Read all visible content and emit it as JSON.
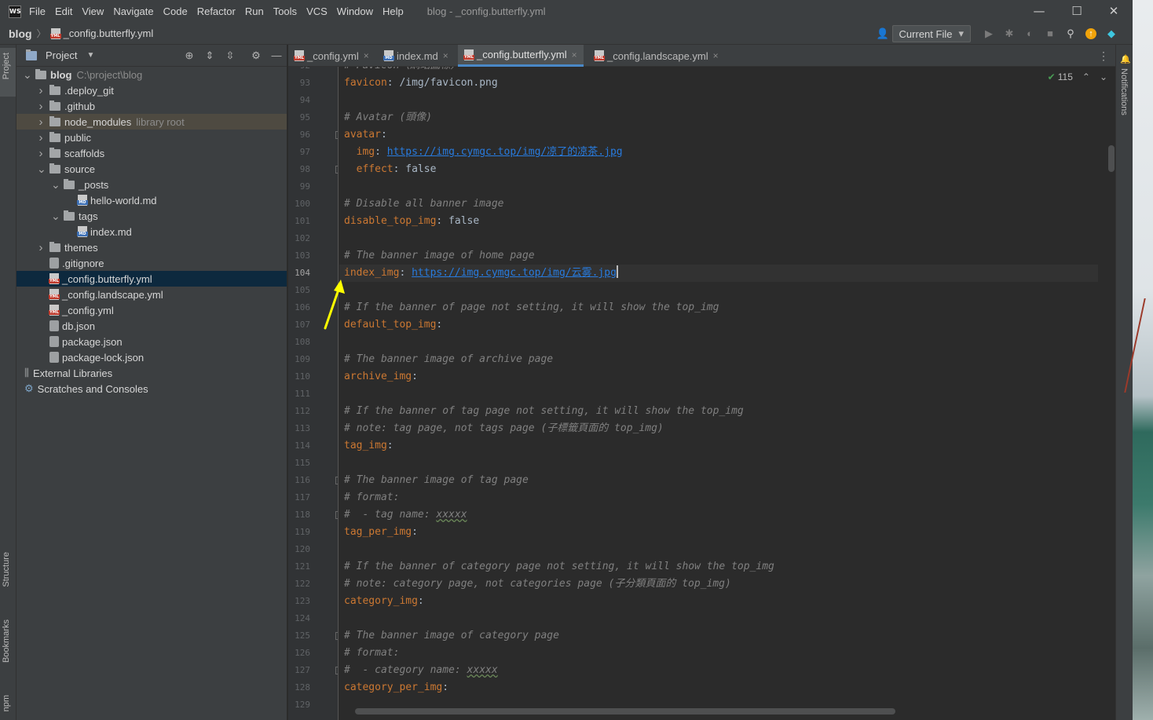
{
  "titlebar": {
    "app_logo": "WS",
    "menu": [
      "File",
      "Edit",
      "View",
      "Navigate",
      "Code",
      "Refactor",
      "Run",
      "Tools",
      "VCS",
      "Window",
      "Help"
    ],
    "window_title": "blog - _config.butterfly.yml",
    "controls": {
      "minimize": "—",
      "maximize": "☐",
      "close": "✕"
    }
  },
  "navbar": {
    "root": "blog",
    "separator": "〉",
    "file": "_config.butterfly.yml",
    "run_config": "Current File",
    "dropdown": "▾"
  },
  "left_strip": {
    "project": "Project",
    "structure": "Structure",
    "bookmarks": "Bookmarks",
    "npm": "npm"
  },
  "project_panel": {
    "title": "Project",
    "tree": [
      {
        "label": "blog",
        "hint": "C:\\project\\blog",
        "type": "folder",
        "level": 0,
        "expanded": true
      },
      {
        "label": ".deploy_git",
        "type": "folder",
        "level": 1,
        "expanded": false
      },
      {
        "label": ".github",
        "type": "folder",
        "level": 1,
        "expanded": false
      },
      {
        "label": "node_modules",
        "hint": "library root",
        "type": "folder",
        "level": 1,
        "expanded": false,
        "state": "excluded"
      },
      {
        "label": "public",
        "type": "folder",
        "level": 1,
        "expanded": false
      },
      {
        "label": "scaffolds",
        "type": "folder",
        "level": 1,
        "expanded": false
      },
      {
        "label": "source",
        "type": "folder",
        "level": 1,
        "expanded": true
      },
      {
        "label": "_posts",
        "type": "folder",
        "level": 2,
        "expanded": true
      },
      {
        "label": "hello-world.md",
        "type": "md",
        "level": 3
      },
      {
        "label": "tags",
        "type": "folder",
        "level": 2,
        "expanded": true
      },
      {
        "label": "index.md",
        "type": "md",
        "level": 3
      },
      {
        "label": "themes",
        "type": "folder",
        "level": 1,
        "expanded": false
      },
      {
        "label": ".gitignore",
        "type": "cfg",
        "level": 1
      },
      {
        "label": "_config.butterfly.yml",
        "type": "yml",
        "level": 1,
        "state": "selected"
      },
      {
        "label": "_config.landscape.yml",
        "type": "yml",
        "level": 1
      },
      {
        "label": "_config.yml",
        "type": "yml",
        "level": 1
      },
      {
        "label": "db.json",
        "type": "cfg",
        "level": 1
      },
      {
        "label": "package.json",
        "type": "cfg",
        "level": 1
      },
      {
        "label": "package-lock.json",
        "type": "cfg",
        "level": 1
      },
      {
        "label": "External Libraries",
        "type": "lib",
        "level": 0
      },
      {
        "label": "Scratches and Consoles",
        "type": "scratch",
        "level": 0
      }
    ]
  },
  "tabs": [
    {
      "label": "_config.yml",
      "type": "yml",
      "active": false
    },
    {
      "label": "index.md",
      "type": "md",
      "active": false
    },
    {
      "label": "_config.butterfly.yml",
      "type": "yml",
      "active": true
    },
    {
      "label": "_config.landscape.yml",
      "type": "yml",
      "active": false
    }
  ],
  "inspections": {
    "count": "115"
  },
  "editor": {
    "current_line": "104",
    "lines": [
      {
        "n": "92",
        "parts": [
          [
            "c",
            "# Favicon（網站圖標）"
          ]
        ]
      },
      {
        "n": "93",
        "parts": [
          [
            "k",
            "favicon"
          ],
          [
            "p",
            ": /img/favicon.png"
          ]
        ]
      },
      {
        "n": "94",
        "parts": []
      },
      {
        "n": "95",
        "parts": [
          [
            "c",
            "# Avatar (頭像)"
          ]
        ]
      },
      {
        "n": "96",
        "parts": [
          [
            "k",
            "avatar"
          ],
          [
            "p",
            ":"
          ]
        ],
        "fold": true
      },
      {
        "n": "97",
        "parts": [
          [
            "p",
            "  "
          ],
          [
            "k",
            "img"
          ],
          [
            "p",
            ": "
          ],
          [
            "u",
            "https://img.cymgc.top/img/凉了的凉茶.jpg"
          ]
        ]
      },
      {
        "n": "98",
        "parts": [
          [
            "p",
            "  "
          ],
          [
            "k",
            "effect"
          ],
          [
            "p",
            ": false"
          ]
        ],
        "fold": true
      },
      {
        "n": "99",
        "parts": []
      },
      {
        "n": "100",
        "parts": [
          [
            "c",
            "# Disable all banner image"
          ]
        ]
      },
      {
        "n": "101",
        "parts": [
          [
            "k",
            "disable_top_img"
          ],
          [
            "p",
            ": false"
          ]
        ]
      },
      {
        "n": "102",
        "parts": []
      },
      {
        "n": "103",
        "parts": [
          [
            "c",
            "# The banner image of home page"
          ]
        ]
      },
      {
        "n": "104",
        "parts": [
          [
            "k",
            "index_img"
          ],
          [
            "p",
            ": "
          ],
          [
            "u",
            "https://img.cymgc.top/img/云雾.jpg"
          ]
        ],
        "caret": true
      },
      {
        "n": "105",
        "parts": []
      },
      {
        "n": "106",
        "parts": [
          [
            "c",
            "# If the banner of page not setting, it will show the top_img"
          ]
        ]
      },
      {
        "n": "107",
        "parts": [
          [
            "k",
            "default_top_img"
          ],
          [
            "p",
            ":"
          ]
        ]
      },
      {
        "n": "108",
        "parts": []
      },
      {
        "n": "109",
        "parts": [
          [
            "c",
            "# The banner image of archive page"
          ]
        ]
      },
      {
        "n": "110",
        "parts": [
          [
            "k",
            "archive_img"
          ],
          [
            "p",
            ":"
          ]
        ]
      },
      {
        "n": "111",
        "parts": []
      },
      {
        "n": "112",
        "parts": [
          [
            "c",
            "# If the banner of tag page not setting, it will show the top_img"
          ]
        ]
      },
      {
        "n": "113",
        "parts": [
          [
            "c",
            "# note: tag page, not tags page (子標籤頁面的 top_img)"
          ]
        ]
      },
      {
        "n": "114",
        "parts": [
          [
            "k",
            "tag_img"
          ],
          [
            "p",
            ":"
          ]
        ]
      },
      {
        "n": "115",
        "parts": []
      },
      {
        "n": "116",
        "parts": [
          [
            "c",
            "# The banner image of tag page"
          ]
        ],
        "fold": true
      },
      {
        "n": "117",
        "parts": [
          [
            "c",
            "# format:"
          ]
        ]
      },
      {
        "n": "118",
        "parts": [
          [
            "c",
            "#  - tag name: "
          ],
          [
            "cw",
            "xxxxx"
          ]
        ],
        "fold": true
      },
      {
        "n": "119",
        "parts": [
          [
            "k",
            "tag_per_img"
          ],
          [
            "p",
            ":"
          ]
        ]
      },
      {
        "n": "120",
        "parts": []
      },
      {
        "n": "121",
        "parts": [
          [
            "c",
            "# If the banner of category page not setting, it will show the top_img"
          ]
        ]
      },
      {
        "n": "122",
        "parts": [
          [
            "c",
            "# note: category page, not categories page (子分類頁面的 top_img)"
          ]
        ]
      },
      {
        "n": "123",
        "parts": [
          [
            "k",
            "category_img"
          ],
          [
            "p",
            ":"
          ]
        ]
      },
      {
        "n": "124",
        "parts": []
      },
      {
        "n": "125",
        "parts": [
          [
            "c",
            "# The banner image of category page"
          ]
        ],
        "fold": true
      },
      {
        "n": "126",
        "parts": [
          [
            "c",
            "# format:"
          ]
        ]
      },
      {
        "n": "127",
        "parts": [
          [
            "c",
            "#  - category name: "
          ],
          [
            "cw",
            "xxxxx"
          ]
        ],
        "fold": true
      },
      {
        "n": "128",
        "parts": [
          [
            "k",
            "category_per_img"
          ],
          [
            "p",
            ":"
          ]
        ]
      },
      {
        "n": "129",
        "parts": []
      }
    ]
  },
  "right_strip": {
    "notifications": "Notifications"
  },
  "colors": {
    "accent": "#4a88c7",
    "keyword": "#cc7832",
    "comment": "#808080",
    "url": "#287bde",
    "annotation_arrow": "#ffff00"
  }
}
